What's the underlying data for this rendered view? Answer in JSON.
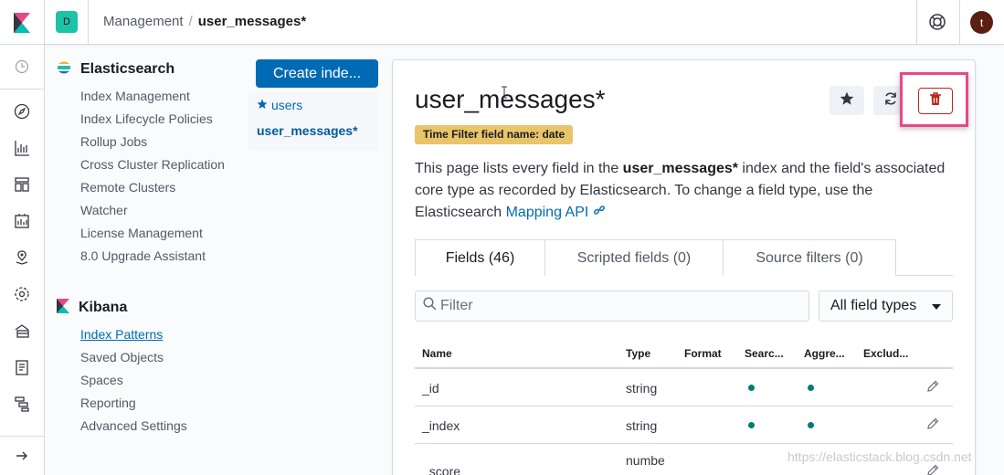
{
  "header": {
    "space_initial": "D",
    "breadcrumb_parent": "Management",
    "breadcrumb_separator": "/",
    "breadcrumb_current": "user_messages*",
    "user_initial": "t"
  },
  "rail": {
    "icons": [
      "clock-icon",
      "discover-icon",
      "visualize-icon",
      "dashboard-icon",
      "canvas-icon",
      "maps-icon",
      "ml-icon",
      "infrastructure-icon",
      "logs-icon",
      "apm-icon",
      "expand-icon"
    ]
  },
  "sidenav": {
    "elasticsearch": {
      "title": "Elasticsearch",
      "items": [
        "Index Management",
        "Index Lifecycle Policies",
        "Rollup Jobs",
        "Cross Cluster Replication",
        "Remote Clusters",
        "Watcher",
        "License Management",
        "8.0 Upgrade Assistant"
      ]
    },
    "kibana": {
      "title": "Kibana",
      "items": [
        "Index Patterns",
        "Saved Objects",
        "Spaces",
        "Reporting",
        "Advanced Settings"
      ]
    }
  },
  "patterns": {
    "create_label": "Create inde...",
    "items": [
      "users",
      "user_messages*"
    ]
  },
  "main": {
    "title": "user_messages*",
    "time_filter_badge": "Time Filter field name: date",
    "desc_pre": "This page lists every field in the ",
    "desc_bold": "user_messages*",
    "desc_post": " index and the field's associated core type as recorded by Elasticsearch. To change a field type, use the Elasticsearch ",
    "desc_link": "Mapping API",
    "tabs": [
      "Fields (46)",
      "Scripted fields (0)",
      "Source filters (0)"
    ],
    "filter_placeholder": "Filter",
    "type_select": "All field types",
    "columns": [
      "Name",
      "Type",
      "Format",
      "Searc...",
      "Aggre...",
      "Exclud..."
    ],
    "rows": [
      {
        "name": "_id",
        "type": "string",
        "searchable": true,
        "aggregatable": true
      },
      {
        "name": "_index",
        "type": "string",
        "searchable": true,
        "aggregatable": true
      },
      {
        "name": "_score",
        "type": "numbe",
        "searchable": false,
        "aggregatable": false
      }
    ]
  },
  "watermark": "https://elasticstack.blog.csdn.net",
  "colors": {
    "accent": "#006bb4",
    "danger": "#bd271e",
    "highlight": "#e8488a",
    "badge": "#e8c46a"
  }
}
